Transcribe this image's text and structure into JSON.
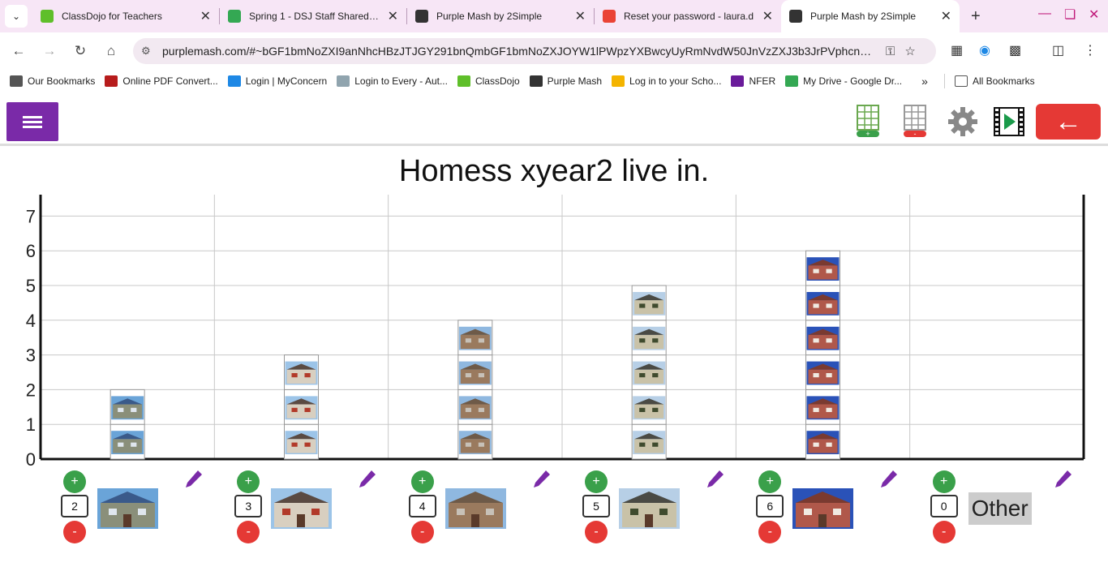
{
  "browser": {
    "tabs": [
      {
        "title": "ClassDojo for Teachers",
        "fav_color": "#5fbf2a",
        "active": false
      },
      {
        "title": "Spring 1 - DSJ Staff Shared - G",
        "fav_color": "#34a853",
        "active": false
      },
      {
        "title": "Purple Mash by 2Simple",
        "fav_color": "#333333",
        "active": false
      },
      {
        "title": "Reset your password - laura.d",
        "fav_color": "#ea4335",
        "active": false
      },
      {
        "title": "Purple Mash by 2Simple",
        "fav_color": "#333333",
        "active": true
      }
    ],
    "url": "purplemash.com/#~bGF1bmNoZXI9anNhcHBzJTJGY291bnQmbGF1bmNoZXJOYW1lPWpzYXBwcyUyRmNvdW50JnVzZXJ3b3JrPVphcnFh...",
    "bookmarks": [
      {
        "label": "Our Bookmarks",
        "color": "#555555"
      },
      {
        "label": "Online PDF Convert...",
        "color": "#b71c1c"
      },
      {
        "label": "Login | MyConcern",
        "color": "#1e88e5"
      },
      {
        "label": "Login to Every - Aut...",
        "color": "#90a4ae"
      },
      {
        "label": "ClassDojo",
        "color": "#5fbf2a"
      },
      {
        "label": "Purple Mash",
        "color": "#333333"
      },
      {
        "label": "Log in to your Scho...",
        "color": "#f4b400"
      },
      {
        "label": "NFER",
        "color": "#6a1b9a"
      },
      {
        "label": "My Drive - Google Dr...",
        "color": "#34a853"
      }
    ],
    "all_bookmarks": "All Bookmarks"
  },
  "app": {
    "accent": "#7a2aa8",
    "back_color": "#e53935"
  },
  "chart_data": {
    "type": "bar",
    "title": "Homess xyear2 live in.",
    "xlabel": "",
    "ylabel": "",
    "ylim": [
      0,
      7.5
    ],
    "yticks": [
      "0",
      "1",
      "2",
      "3",
      "4",
      "5",
      "6",
      "7"
    ],
    "categories": [
      "Bungalow",
      "Detached house",
      "Flat",
      "Semi-detached house",
      "Terraced house",
      "Other"
    ],
    "values": [
      2,
      3,
      4,
      5,
      6,
      0
    ],
    "category_labels_visible": [
      "",
      "",
      "",
      "",
      "",
      "Other"
    ],
    "grid": true
  }
}
